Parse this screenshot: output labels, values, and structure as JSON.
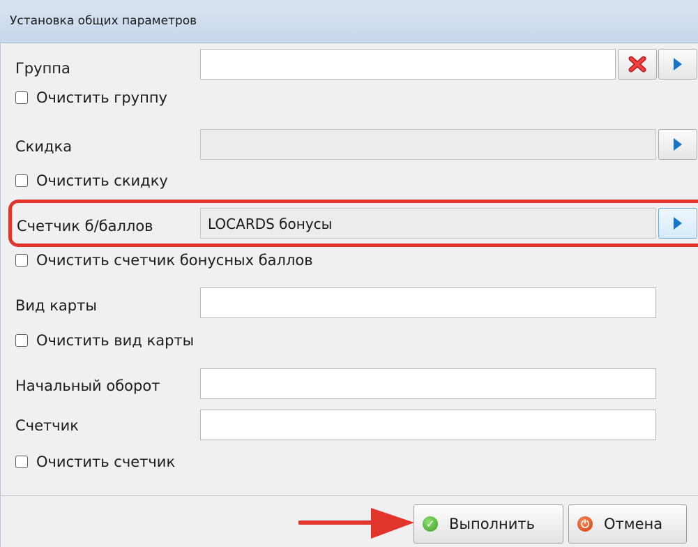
{
  "window": {
    "title": "Установка общих параметров"
  },
  "rows": {
    "group": {
      "label": "Группа",
      "value": "",
      "clear_checkbox": "Очистить группу"
    },
    "discount": {
      "label": "Скидка",
      "value": "",
      "clear_checkbox": "Очистить скидку"
    },
    "bonus_counter": {
      "label": "Счетчик б/баллов",
      "value": "LOCARDS бонусы",
      "clear_checkbox": "Очистить счетчик бонусных баллов"
    },
    "card_type": {
      "label": "Вид карты",
      "value": "",
      "clear_checkbox": "Очистить вид карты"
    },
    "initial_turnover": {
      "label": "Начальный оборот",
      "value": ""
    },
    "counter": {
      "label": "Счетчик",
      "value": "",
      "clear_checkbox": "Очистить счетчик"
    }
  },
  "footer": {
    "execute_label": "Выполнить",
    "cancel_label": "Отмена"
  },
  "icons": {
    "clear": "close-x-icon",
    "select": "play-triangle-icon",
    "execute": "check-circle-icon",
    "cancel": "power-icon"
  },
  "colors": {
    "highlight": "#e0342c",
    "titlebar": "#c6d7ec",
    "accent": "#1a74c4"
  }
}
